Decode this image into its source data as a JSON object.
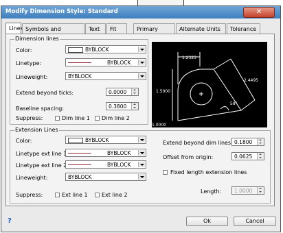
{
  "window": {
    "title": "Modify Dimension Style: Standard",
    "close_label": "✕"
  },
  "tabs": [
    {
      "label": "Lines"
    },
    {
      "label": "Symbols and Arrows"
    },
    {
      "label": "Text"
    },
    {
      "label": "Fit"
    },
    {
      "label": "Primary Units"
    },
    {
      "label": "Alternate Units"
    },
    {
      "label": "Tolerance"
    }
  ],
  "dimension_lines": {
    "group_title": "Dimension lines",
    "color_label": "Color:",
    "color_value": "BYBLOCK",
    "linetype_label": "Linetype:",
    "linetype_value": "BYBLOCK",
    "lineweight_label": "Lineweight:",
    "lineweight_value": "BYBLOCK",
    "extend_label": "Extend beyond ticks:",
    "extend_value": "0.0000",
    "baseline_label": "Baseline spacing:",
    "baseline_value": "0.3800",
    "suppress_label": "Suppress:",
    "suppress_1": "Dim line 1",
    "suppress_2": "Dim line 2"
  },
  "extension_lines": {
    "group_title": "Extension Lines",
    "color_label": "Color:",
    "color_value": "BYBLOCK",
    "linetype1_label": "Linetype ext line 1:",
    "linetype1_value": "BYBLOCK",
    "linetype2_label": "Linetype ext line 2:",
    "linetype2_value": "BYBLOCK",
    "lineweight_label": "Lineweight:",
    "lineweight_value": "BYBLOCK",
    "suppress_label": "Suppress:",
    "suppress_1": "Ext line 1",
    "suppress_2": "Ext line 2",
    "extend_beyond_label": "Extend beyond dim lines:",
    "extend_beyond_value": "0.1800",
    "offset_label": "Offset from origin:",
    "offset_value": "0.0625",
    "fixed_length_label": "Fixed length extension lines",
    "length_label": "Length:",
    "length_value": "1.0000"
  },
  "preview": {
    "dim_top": "1.2323",
    "dim_left": "1.5000",
    "dim_right": "2.4495",
    "angle": "58°",
    "dim_bottom": "1.0000"
  },
  "footer": {
    "help_label": "?",
    "ok_label": "Ok",
    "cancel_label": "Cancel"
  }
}
